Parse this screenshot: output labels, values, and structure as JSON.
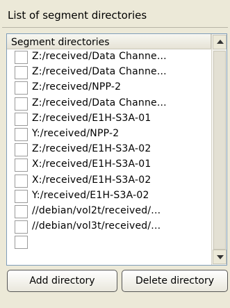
{
  "group": {
    "title": "List of segment directories"
  },
  "list": {
    "header": "Segment directories",
    "items": [
      {
        "label": "Z:/received/Data Channe...",
        "checked": false
      },
      {
        "label": "Z:/received/Data Channe...",
        "checked": false
      },
      {
        "label": "Z:/received/NPP-2",
        "checked": false
      },
      {
        "label": "Z:/received/Data Channe...",
        "checked": false
      },
      {
        "label": "Z:/received/E1H-S3A-01",
        "checked": false
      },
      {
        "label": "Y:/received/NPP-2",
        "checked": false
      },
      {
        "label": "Z:/received/E1H-S3A-02",
        "checked": false
      },
      {
        "label": "X:/received/E1H-S3A-01",
        "checked": false
      },
      {
        "label": "X:/received/E1H-S3A-02",
        "checked": false
      },
      {
        "label": "Y:/received/E1H-S3A-02",
        "checked": false
      },
      {
        "label": "//debian/vol2t/received/...",
        "checked": false
      },
      {
        "label": "//debian/vol3t/received/...",
        "checked": false
      },
      {
        "label": "",
        "checked": false
      }
    ]
  },
  "buttons": {
    "add_label": "Add directory",
    "delete_label": "Delete directory"
  }
}
